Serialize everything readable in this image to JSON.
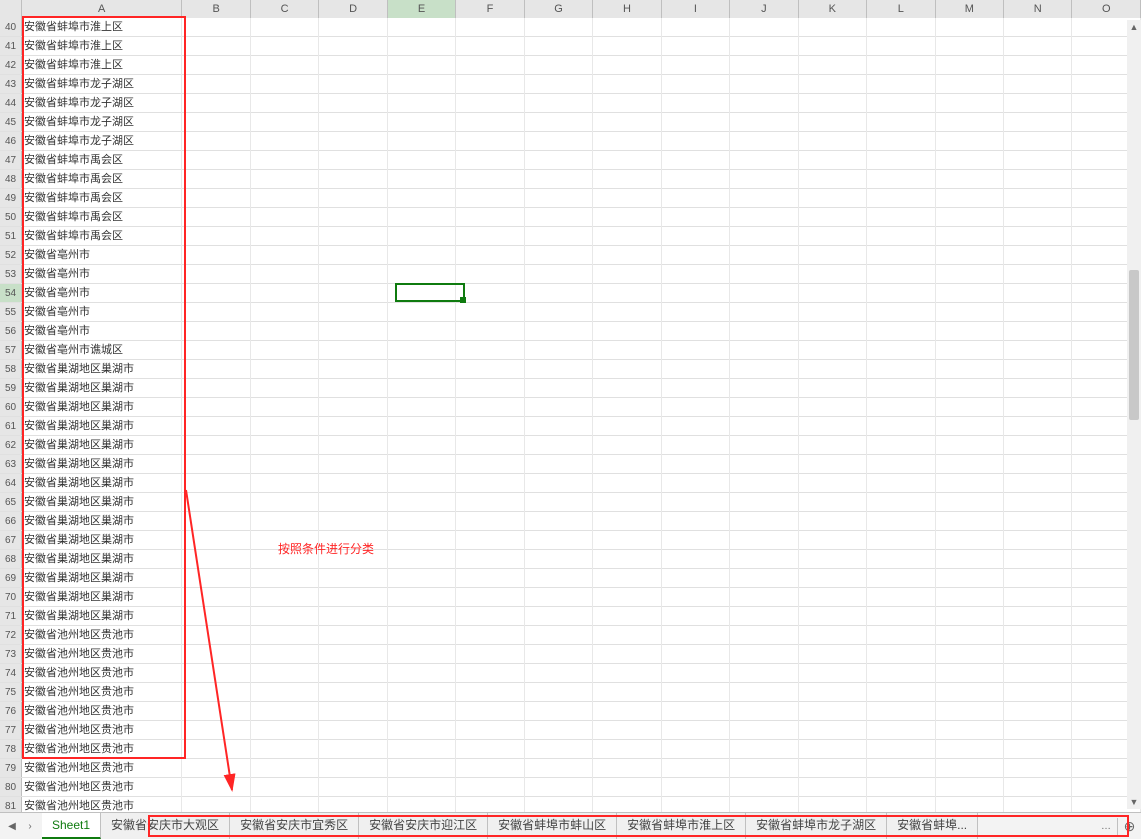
{
  "columns": [
    "A",
    "B",
    "C",
    "D",
    "E",
    "F",
    "G",
    "H",
    "I",
    "J",
    "K",
    "L",
    "M",
    "N",
    "O"
  ],
  "first_row": 40,
  "selected_cell": "E54",
  "rows": [
    {
      "n": 40,
      "a": "安徽省蚌埠市淮上区"
    },
    {
      "n": 41,
      "a": "安徽省蚌埠市淮上区"
    },
    {
      "n": 42,
      "a": "安徽省蚌埠市淮上区"
    },
    {
      "n": 43,
      "a": "安徽省蚌埠市龙子湖区"
    },
    {
      "n": 44,
      "a": "安徽省蚌埠市龙子湖区"
    },
    {
      "n": 45,
      "a": "安徽省蚌埠市龙子湖区"
    },
    {
      "n": 46,
      "a": "安徽省蚌埠市龙子湖区"
    },
    {
      "n": 47,
      "a": "安徽省蚌埠市禹会区"
    },
    {
      "n": 48,
      "a": "安徽省蚌埠市禹会区"
    },
    {
      "n": 49,
      "a": "安徽省蚌埠市禹会区"
    },
    {
      "n": 50,
      "a": "安徽省蚌埠市禹会区"
    },
    {
      "n": 51,
      "a": "安徽省蚌埠市禹会区"
    },
    {
      "n": 52,
      "a": "安徽省亳州市"
    },
    {
      "n": 53,
      "a": "安徽省亳州市"
    },
    {
      "n": 54,
      "a": "安徽省亳州市"
    },
    {
      "n": 55,
      "a": "安徽省亳州市"
    },
    {
      "n": 56,
      "a": "安徽省亳州市"
    },
    {
      "n": 57,
      "a": "安徽省亳州市谯城区"
    },
    {
      "n": 58,
      "a": "安徽省巢湖地区巢湖市"
    },
    {
      "n": 59,
      "a": "安徽省巢湖地区巢湖市"
    },
    {
      "n": 60,
      "a": "安徽省巢湖地区巢湖市"
    },
    {
      "n": 61,
      "a": "安徽省巢湖地区巢湖市"
    },
    {
      "n": 62,
      "a": "安徽省巢湖地区巢湖市"
    },
    {
      "n": 63,
      "a": "安徽省巢湖地区巢湖市"
    },
    {
      "n": 64,
      "a": "安徽省巢湖地区巢湖市"
    },
    {
      "n": 65,
      "a": "安徽省巢湖地区巢湖市"
    },
    {
      "n": 66,
      "a": "安徽省巢湖地区巢湖市"
    },
    {
      "n": 67,
      "a": "安徽省巢湖地区巢湖市"
    },
    {
      "n": 68,
      "a": "安徽省巢湖地区巢湖市"
    },
    {
      "n": 69,
      "a": "安徽省巢湖地区巢湖市"
    },
    {
      "n": 70,
      "a": "安徽省巢湖地区巢湖市"
    },
    {
      "n": 71,
      "a": "安徽省巢湖地区巢湖市"
    },
    {
      "n": 72,
      "a": "安徽省池州地区贵池市"
    },
    {
      "n": 73,
      "a": "安徽省池州地区贵池市"
    },
    {
      "n": 74,
      "a": "安徽省池州地区贵池市"
    },
    {
      "n": 75,
      "a": "安徽省池州地区贵池市"
    },
    {
      "n": 76,
      "a": "安徽省池州地区贵池市"
    },
    {
      "n": 77,
      "a": "安徽省池州地区贵池市"
    },
    {
      "n": 78,
      "a": "安徽省池州地区贵池市"
    },
    {
      "n": 79,
      "a": "安徽省池州地区贵池市"
    },
    {
      "n": 80,
      "a": "安徽省池州地区贵池市"
    },
    {
      "n": 81,
      "a": "安徽省池州地区贵池市"
    }
  ],
  "annotation_text": "按照条件进行分类",
  "tabs": {
    "active": "Sheet1",
    "items": [
      "Sheet1",
      "安徽省安庆市大观区",
      "安徽省安庆市宜秀区",
      "安徽省安庆市迎江区",
      "安徽省蚌埠市蚌山区",
      "安徽省蚌埠市淮上区",
      "安徽省蚌埠市龙子湖区",
      "安徽省蚌埠..."
    ]
  },
  "nav": {
    "first": "◀",
    "prev": "‹",
    "next": "›",
    "more": "…",
    "add": "⊕"
  }
}
